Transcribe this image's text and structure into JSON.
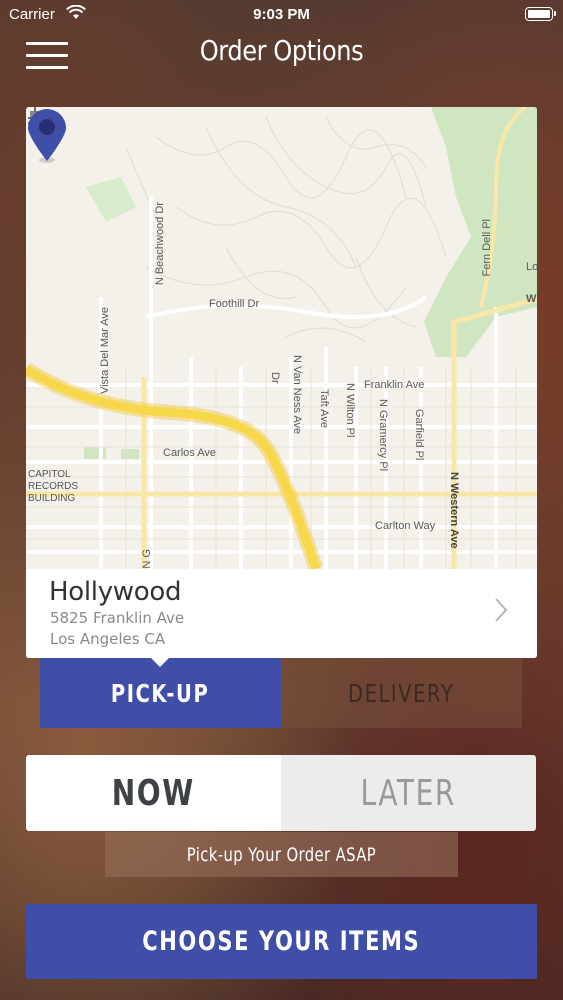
{
  "status_bar": {
    "carrier": "Carrier",
    "time": "9:03 PM",
    "icons": [
      "wifi-icon",
      "battery-icon"
    ]
  },
  "nav": {
    "title": "Order Options",
    "menu_icon": "hamburger-menu-icon"
  },
  "map": {
    "labels": {
      "foothill_dr": "Foothill Dr",
      "franklin_ave": "Franklin Ave",
      "carlos_ave": "Carlos Ave",
      "carlton_way": "Carlton Way",
      "n_beachwood_dr": "N Beachwood Dr",
      "vista_del_mar_ave": "Vista Del Mar Ave",
      "n_van_ness_ave": "N Van Ness Ave",
      "taft_ave": "Taft Ave",
      "n_wilton_pl": "N Wilton Pl",
      "n_gramercy_pl": "N Gramercy Pl",
      "garfield_pl": "Garfield Pl",
      "n_western_ave": "N Western Ave",
      "fern_dell_pl": "Fern Dell Pl",
      "edge_w": "W",
      "edge_lo": "Lo",
      "edge_n_g": "N G",
      "edge_dr": "Dr",
      "poi": "CAPITOL\nRECORDS\nBUILDING"
    },
    "colors": {
      "background": "#f3f1ea",
      "park": "#cfe6c0",
      "freeway": "#f7d84a",
      "road": "#ffffff",
      "pin": "#3f4fa8"
    },
    "pin_icon": "location-pin-icon"
  },
  "location": {
    "name": "Hollywood",
    "street": "5825 Franklin Ave",
    "city": "Los Angeles CA",
    "chevron_icon": "chevron-right-icon"
  },
  "order_type": {
    "options": [
      "PICK-UP",
      "DELIVERY"
    ],
    "selected": "PICK-UP"
  },
  "timing": {
    "options": [
      "NOW",
      "LATER"
    ],
    "selected": "NOW"
  },
  "asap_message": "Pick-up Your Order ASAP",
  "cta_label": "CHOOSE YOUR ITEMS",
  "colors": {
    "accent": "#3f4fa8",
    "white": "#ffffff"
  }
}
